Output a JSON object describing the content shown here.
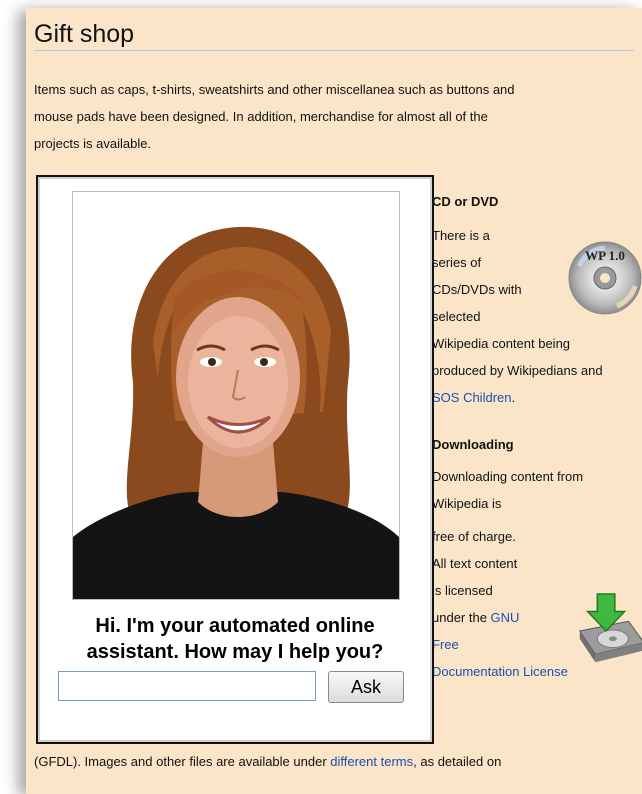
{
  "section": {
    "heading": "Gift shop",
    "intro_lines": [
      "Items such as caps, t-shirts, sweatshirts and other miscellanea such as buttons and",
      "mouse pads have been designed. In addition, merchandise for almost all of the",
      "projects is available."
    ]
  },
  "cd": {
    "title": "CD or DVD",
    "lines": [
      "There is a",
      "series of",
      "CDs/DVDs with",
      "selected",
      "Wikipedia content being",
      "produced by Wikipedians and"
    ],
    "link": "SOS Children",
    "after_link": ".",
    "icon": "cd-disc-icon",
    "icon_label": "WP 1.0"
  },
  "download": {
    "title": "Downloading",
    "lines": [
      "Downloading content from",
      "Wikipedia is",
      "free of charge.",
      "All text content",
      "is licensed"
    ],
    "under_the": "under the ",
    "link_gnu": "GNU",
    "link_free": "Free",
    "link_doc": "Documentation License",
    "icon": "download-disk-icon"
  },
  "footer": {
    "before": "(GFDL). Images and other files are available under ",
    "link": "different terms",
    "after": ", as detailed on"
  },
  "assistant": {
    "greeting_line1": "Hi. I'm your automated online",
    "greeting_line2": "assistant. How may I help you?",
    "input_value": "",
    "input_placeholder": "",
    "ask_label": "Ask",
    "photo": "assistant-portrait"
  },
  "colors": {
    "page_bg": "#fbe5c8",
    "link": "#1a4fb0"
  }
}
